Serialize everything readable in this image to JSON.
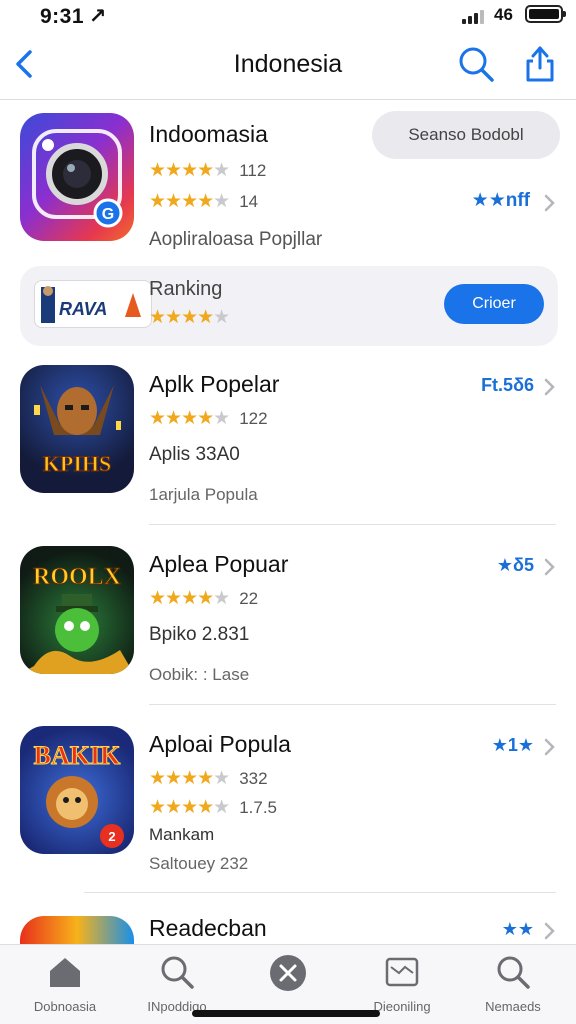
{
  "status_bar": {
    "time": "9:31 ↗",
    "network": "46"
  },
  "nav": {
    "title": "Indonesia"
  },
  "featured": {
    "title": "Indoomasia",
    "rating_1": {
      "stars": 4,
      "count": "112"
    },
    "rating_2": {
      "stars": 3.5,
      "count": "14"
    },
    "button": "Seanso Bodobl",
    "badge": "★★nff",
    "subtitle": "Aopliraloasa Popjllar"
  },
  "ranking_card": {
    "logo_text": "RAVA",
    "label": "Ranking",
    "stars": 3.5,
    "button": "Crioer"
  },
  "apps": [
    {
      "title": "Aplk Popelar",
      "stars": 3.5,
      "count": "122",
      "line": "Aplis 33A0",
      "meta": "1arjula Popula",
      "badge": "Ft.5δ6",
      "icon": "game-hero-icon",
      "icon_text": "KPIHS"
    },
    {
      "title": "Aplea Popuar",
      "stars": 3.5,
      "count": "22",
      "line": "Bpiko 2.831",
      "meta": "Oobik: : Lase",
      "badge": "★δ5",
      "icon": "game-roolix-icon",
      "icon_text": "ROOLX"
    },
    {
      "title": "Aploai Popula",
      "stars": 3.5,
      "count": "332",
      "stars_2": 4,
      "count_2": "1.7.5",
      "line": "Mankam",
      "meta": "Saltouey 232",
      "badge": "★1★",
      "icon": "game-lion-icon",
      "icon_text": "BAKIK"
    },
    {
      "title": "Readecban",
      "badge": "★★",
      "icon": "colorful-app-icon"
    }
  ],
  "tabbar": {
    "tabs": [
      {
        "label": "Dobnoasia",
        "icon": "home-icon"
      },
      {
        "label": "INpoddiqo",
        "icon": "search-icon"
      },
      {
        "label": "",
        "icon": "close-circle-icon"
      },
      {
        "label": "Dieoniling",
        "icon": "folder-icon"
      },
      {
        "label": "Nemaeds",
        "icon": "search-icon"
      }
    ]
  },
  "colors": {
    "accent": "#1a73e8",
    "star": "#f0a81c",
    "text": "#111111"
  }
}
